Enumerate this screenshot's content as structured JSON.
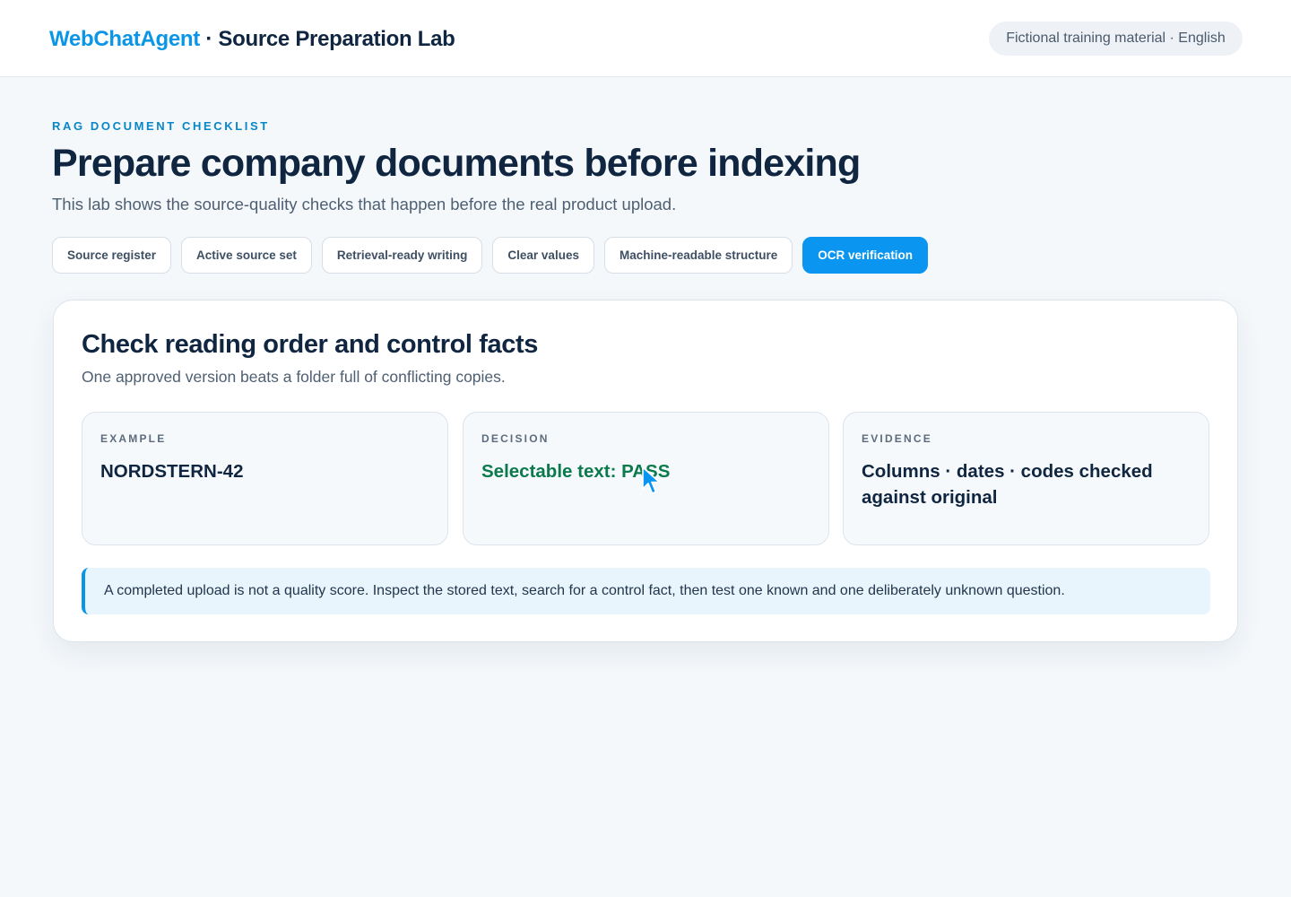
{
  "header": {
    "brand_logo": "WebChatAgent",
    "brand_separator": " · ",
    "brand_title": "Source Preparation Lab",
    "badge": "Fictional training material · English"
  },
  "hero": {
    "eyebrow": "RAG DOCUMENT CHECKLIST",
    "title": "Prepare company documents before indexing",
    "subtitle": "This lab shows the source-quality checks that happen before the real product upload."
  },
  "tabs": [
    {
      "label": "Source register",
      "active": false
    },
    {
      "label": "Active source set",
      "active": false
    },
    {
      "label": "Retrieval-ready writing",
      "active": false
    },
    {
      "label": "Clear values",
      "active": false
    },
    {
      "label": "Machine-readable structure",
      "active": false
    },
    {
      "label": "OCR verification",
      "active": true
    }
  ],
  "card": {
    "title": "Check reading order and control facts",
    "subtitle": "One approved version beats a folder full of conflicting copies.",
    "boxes": [
      {
        "label": "EXAMPLE",
        "value": "NORDSTERN-42"
      },
      {
        "label": "DECISION",
        "value": "Selectable text: PASS"
      },
      {
        "label": "EVIDENCE",
        "value": "Columns · dates · codes checked against original"
      }
    ],
    "note": "A completed upload is not a quality score. Inspect the stored text, search for a control fact, then test one known and one deliberately unknown question."
  },
  "colors": {
    "accent": "#0a96f0",
    "brand": "#0a96e6",
    "pass": "#0b7a4d",
    "heading": "#0f2540",
    "background": "#f4f8fb"
  },
  "icons": {
    "cursor": "mouse-pointer-icon"
  }
}
